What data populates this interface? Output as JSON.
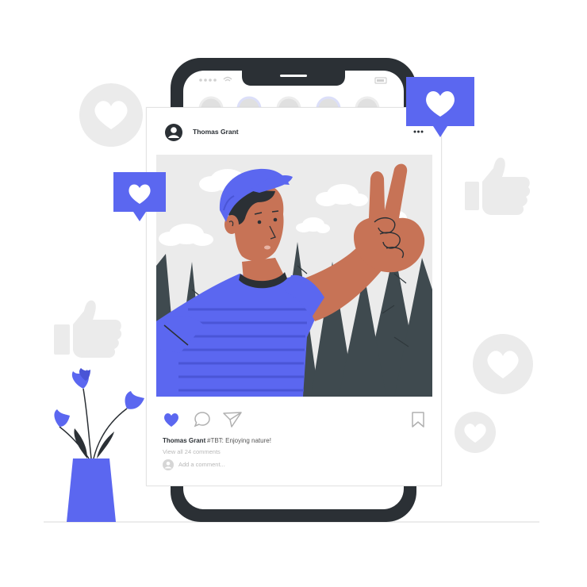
{
  "colors": {
    "accent": "#5b67f0",
    "dark": "#2b3035",
    "light_gray": "#ebebeb",
    "skin": "#c77356",
    "tree": "#3f4a4f"
  },
  "post": {
    "username": "Thomas Grant",
    "caption_user": "Thomas Grant",
    "caption_text": "#TBT: Enjoying nature!",
    "view_comments": "View all 24 comments",
    "add_comment_placeholder": "Add a comment..."
  },
  "icons": {
    "like": "heart-filled-icon",
    "comment": "speech-bubble-icon",
    "share": "paper-plane-icon",
    "save": "bookmark-icon",
    "more": "ellipsis-icon"
  }
}
